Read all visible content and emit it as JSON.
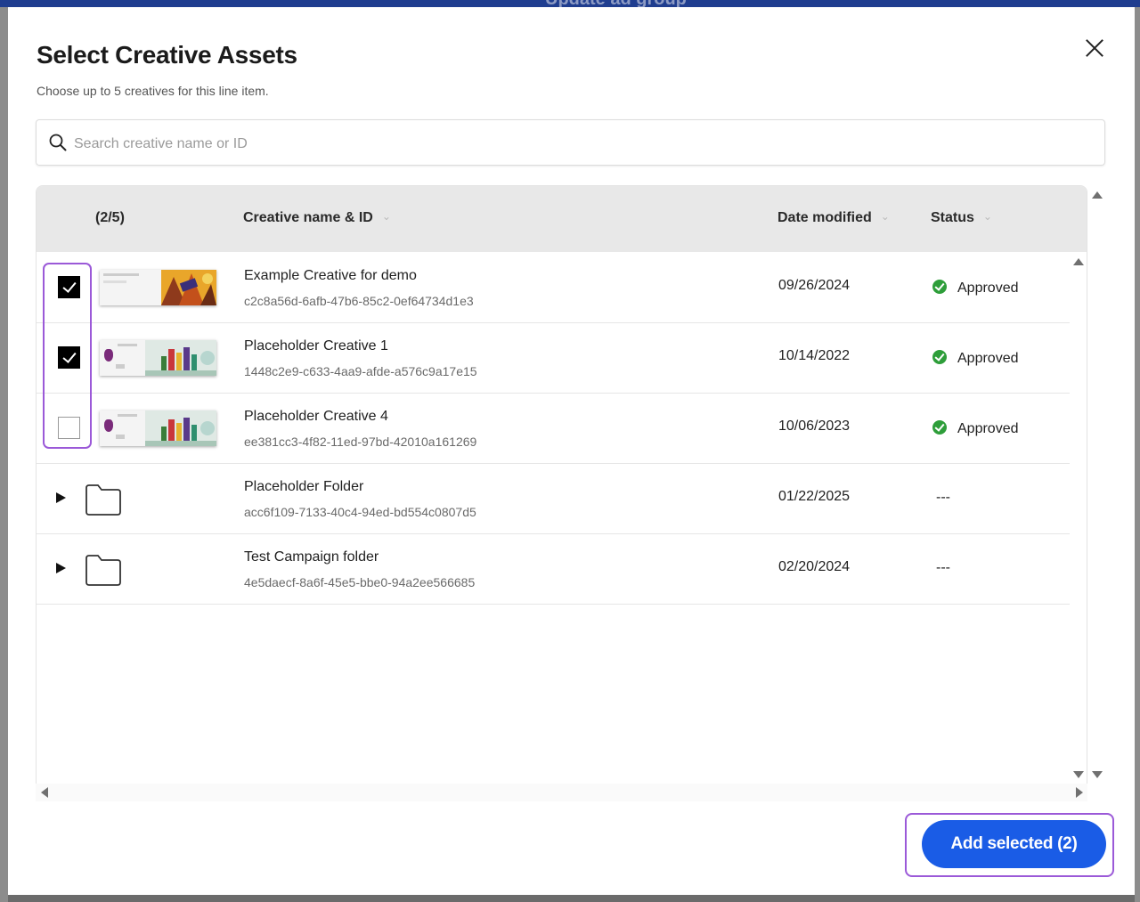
{
  "background": {
    "title": "Update ad group"
  },
  "modal": {
    "title": "Select Creative Assets",
    "subtitle": "Choose up to 5 creatives for this line item."
  },
  "search": {
    "placeholder": "Search creative name or ID",
    "value": ""
  },
  "table": {
    "headers": {
      "selection": "(2/5)",
      "name": "Creative name & ID",
      "date": "Date modified",
      "status": "Status"
    },
    "rows": [
      {
        "type": "creative",
        "checked": true,
        "name": "Example Creative for demo",
        "id": "c2c8a56d-6afb-47b6-85c2-0ef64734d1e3",
        "date": "09/26/2024",
        "status": "Approved"
      },
      {
        "type": "creative",
        "checked": true,
        "name": "Placeholder Creative 1",
        "id": "1448c2e9-c633-4aa9-afde-a576c9a17e15",
        "date": "10/14/2022",
        "status": "Approved"
      },
      {
        "type": "creative",
        "checked": false,
        "name": "Placeholder Creative 4",
        "id": "ee381cc3-4f82-11ed-97bd-42010a161269",
        "date": "10/06/2023",
        "status": "Approved"
      },
      {
        "type": "folder",
        "name": "Placeholder Folder",
        "id": "acc6f109-7133-40c4-94ed-bd554c0807d5",
        "date": "01/22/2025",
        "status": "---"
      },
      {
        "type": "folder",
        "name": "Test Campaign folder",
        "id": "4e5daecf-8a6f-45e5-bbe0-94a2ee566685",
        "date": "02/20/2024",
        "status": "---"
      }
    ]
  },
  "footer": {
    "add_label": "Add selected (2)"
  },
  "colors": {
    "primary": "#1a5ce6",
    "highlight": "#9b59d8",
    "approved": "#2e9e3a"
  }
}
